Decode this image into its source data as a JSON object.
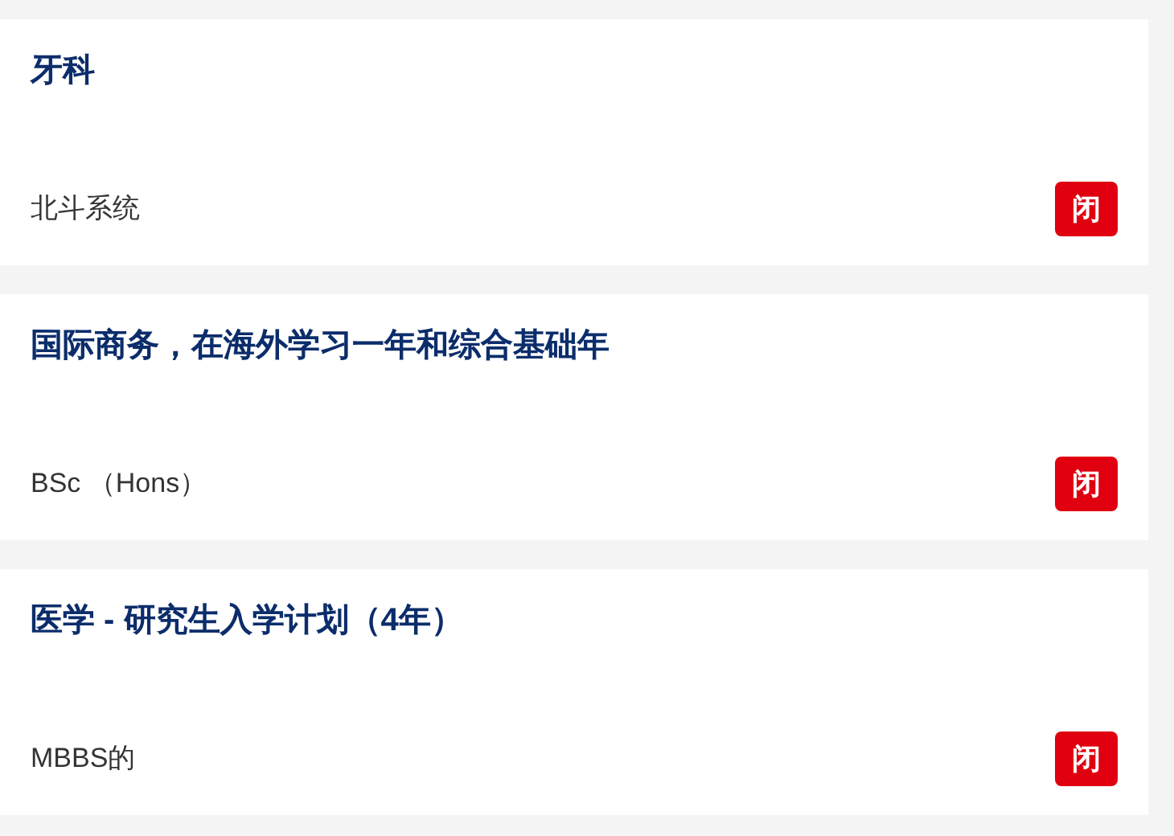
{
  "courses": [
    {
      "title": "牙科",
      "award": "北斗系统",
      "status": "闭"
    },
    {
      "title": "国际商务，在海外学习一年和综合基础年",
      "award": "BSc （Hons）",
      "status": "闭"
    },
    {
      "title": "医学 - 研究生入学计划（4年）",
      "award": "MBBS的",
      "status": "闭"
    }
  ]
}
